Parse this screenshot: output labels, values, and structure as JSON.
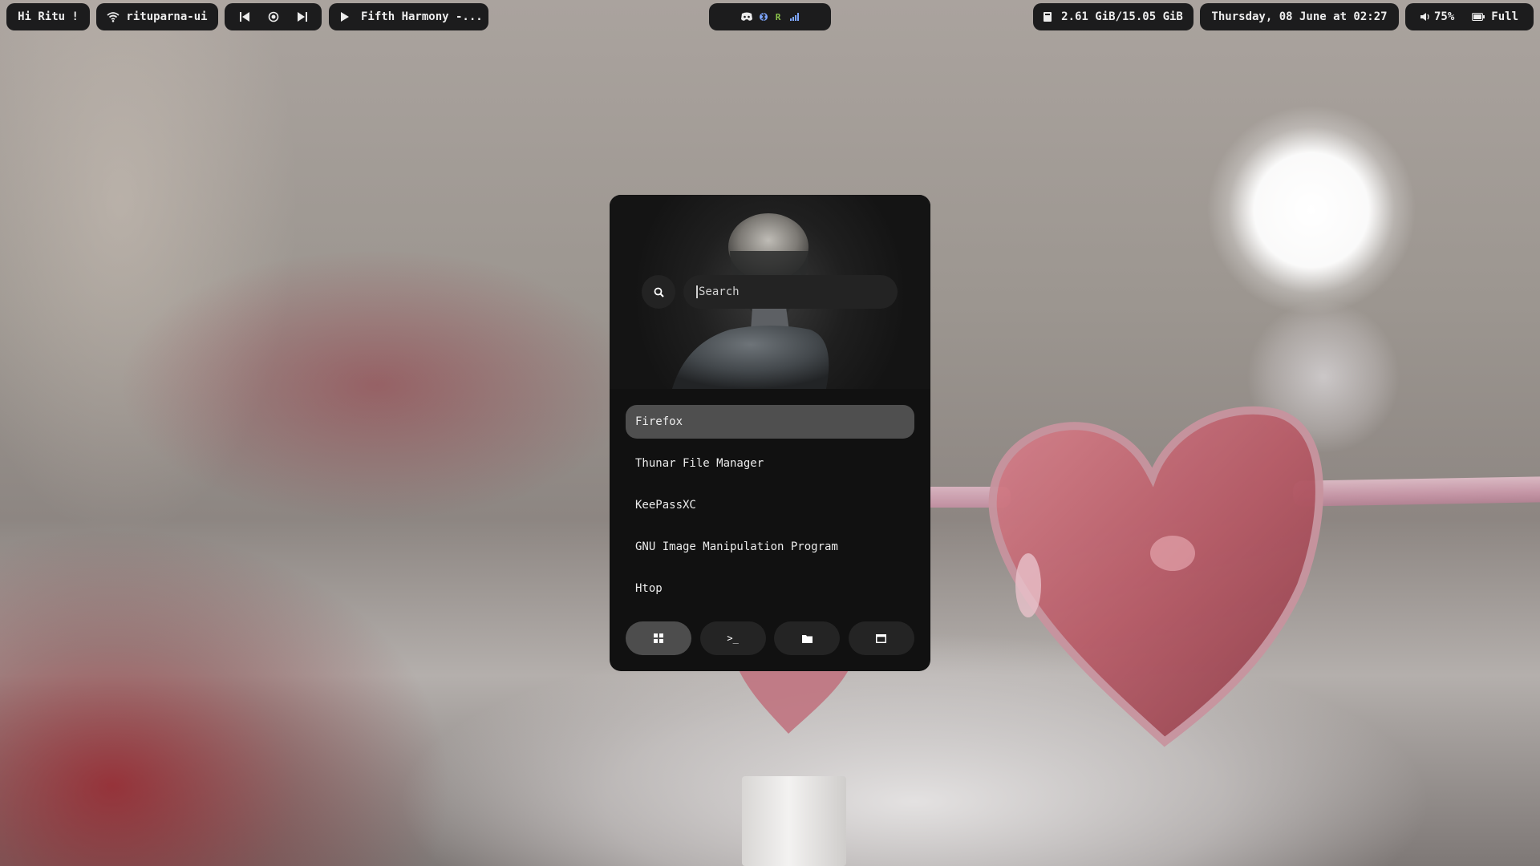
{
  "topbar": {
    "greeting": "Hi Ritu !",
    "wifi": {
      "icon": "wifi-icon",
      "ssid": "rituparna-ui"
    },
    "media_controls": {
      "prev_icon": "skip-previous-icon",
      "center_icon": "record-icon",
      "next_icon": "skip-next-icon"
    },
    "now_playing": {
      "icon": "play-icon",
      "title": "Fifth Harmony -..."
    },
    "tray": {
      "icons": [
        "discord-icon",
        "bluetooth-icon",
        "r-app-icon",
        "signal-bars-icon"
      ],
      "r_label": "R",
      "colors": {
        "r": "#8bc34a",
        "bluetooth": "#7ea6ff",
        "signal": "#7ea6ff"
      }
    },
    "memory": {
      "icon": "memory-icon",
      "value": "2.61 GiB/15.05 GiB"
    },
    "datetime": "Thursday, 08 June at 02:27",
    "volume": {
      "icon": "speaker-icon",
      "value": "75%"
    },
    "battery": {
      "icon": "battery-icon",
      "value": "Full"
    }
  },
  "launcher": {
    "search": {
      "icon": "search-icon",
      "placeholder": "Search",
      "value": ""
    },
    "apps": [
      {
        "label": "Firefox",
        "selected": true
      },
      {
        "label": "Thunar File Manager",
        "selected": false
      },
      {
        "label": "KeePassXC",
        "selected": false
      },
      {
        "label": "GNU Image Manipulation Program",
        "selected": false
      },
      {
        "label": "Htop",
        "selected": false
      }
    ],
    "modes": [
      {
        "icon": "grid-apps-icon",
        "active": true
      },
      {
        "icon": "terminal-prompt-icon",
        "label": ">_",
        "active": false
      },
      {
        "icon": "folder-icon",
        "active": false
      },
      {
        "icon": "window-icon",
        "active": false
      }
    ]
  }
}
